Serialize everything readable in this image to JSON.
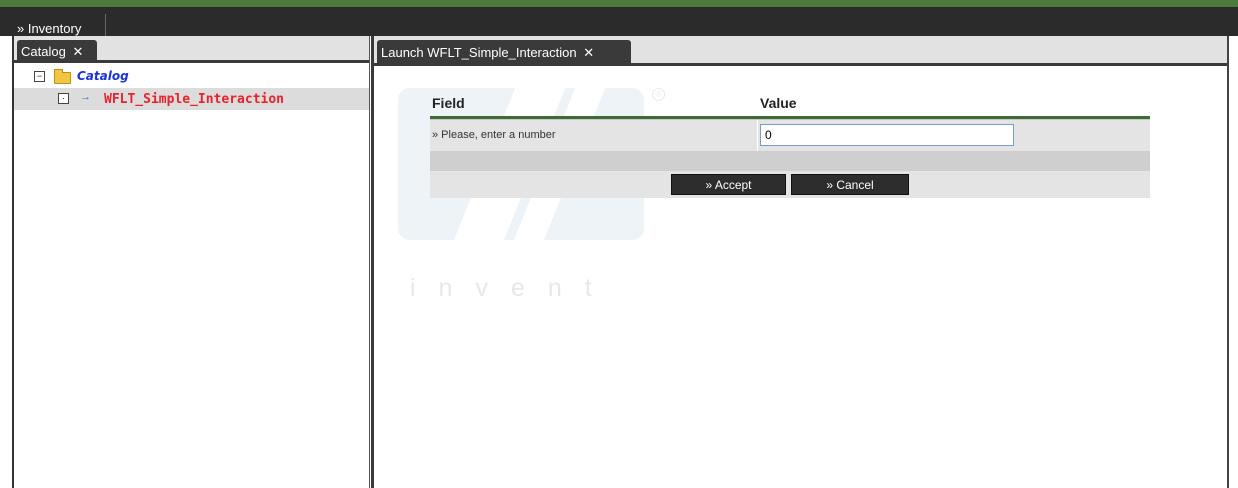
{
  "topbar": {
    "tab_label": "» Inventory"
  },
  "left_panel": {
    "tab_label": "Catalog",
    "tab_close": "✕",
    "tree": {
      "root": {
        "toggle": "−",
        "label": "Catalog"
      },
      "child": {
        "toggle": "·",
        "arrow": "→",
        "label": "WFLT_Simple_Interaction"
      }
    }
  },
  "right_panel": {
    "tab_label": "Launch WFLT_Simple_Interaction",
    "tab_close": "✕",
    "watermark": {
      "text": "invent",
      "reg_mark": "®"
    },
    "form": {
      "header_field": "Field",
      "header_value": "Value",
      "row_label": "» Please, enter a number",
      "input_value": "0",
      "accept_label": "» Accept",
      "cancel_label": "» Cancel"
    }
  },
  "colors": {
    "topbar_bg": "#2b2b2b",
    "accent_green": "#3f6b35",
    "catalog_blue": "#1a33d6",
    "item_red": "#e8222b",
    "button_bg": "#2d2d2d"
  }
}
